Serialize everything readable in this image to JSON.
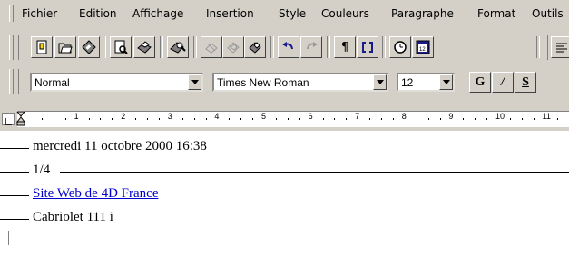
{
  "menu": {
    "items": [
      "Fichier",
      "Edition",
      "Affichage",
      "Insertion",
      "Style",
      "Couleurs",
      "Paragraphe",
      "Format",
      "Outils"
    ]
  },
  "toolbar": {
    "buttons": [
      "new-document",
      "open-folder",
      "save-disk",
      "print-preview",
      "print",
      "spell-check",
      "cut",
      "copy",
      "paste",
      "undo",
      "redo",
      "paragraph-marks",
      "fields",
      "clock",
      "calendar-date"
    ]
  },
  "format_bar": {
    "style_value": "Normal",
    "font_value": "Times New Roman",
    "size_value": "12",
    "bold_label": "G",
    "italic_label": "/",
    "underline_label": "S"
  },
  "ruler": {
    "numbers": [
      "1",
      "2",
      "3",
      "4",
      "5",
      "6",
      "7",
      "8",
      "9",
      "10",
      "11"
    ]
  },
  "document": {
    "line1": "mercredi 11 octobre 2000 16:38",
    "line2": "1/4",
    "line3_link": "Site Web de 4D France",
    "line4": "Cabriolet 111 i"
  },
  "colors": {
    "chrome": "#d4d0c8",
    "link": "#0000cc"
  }
}
